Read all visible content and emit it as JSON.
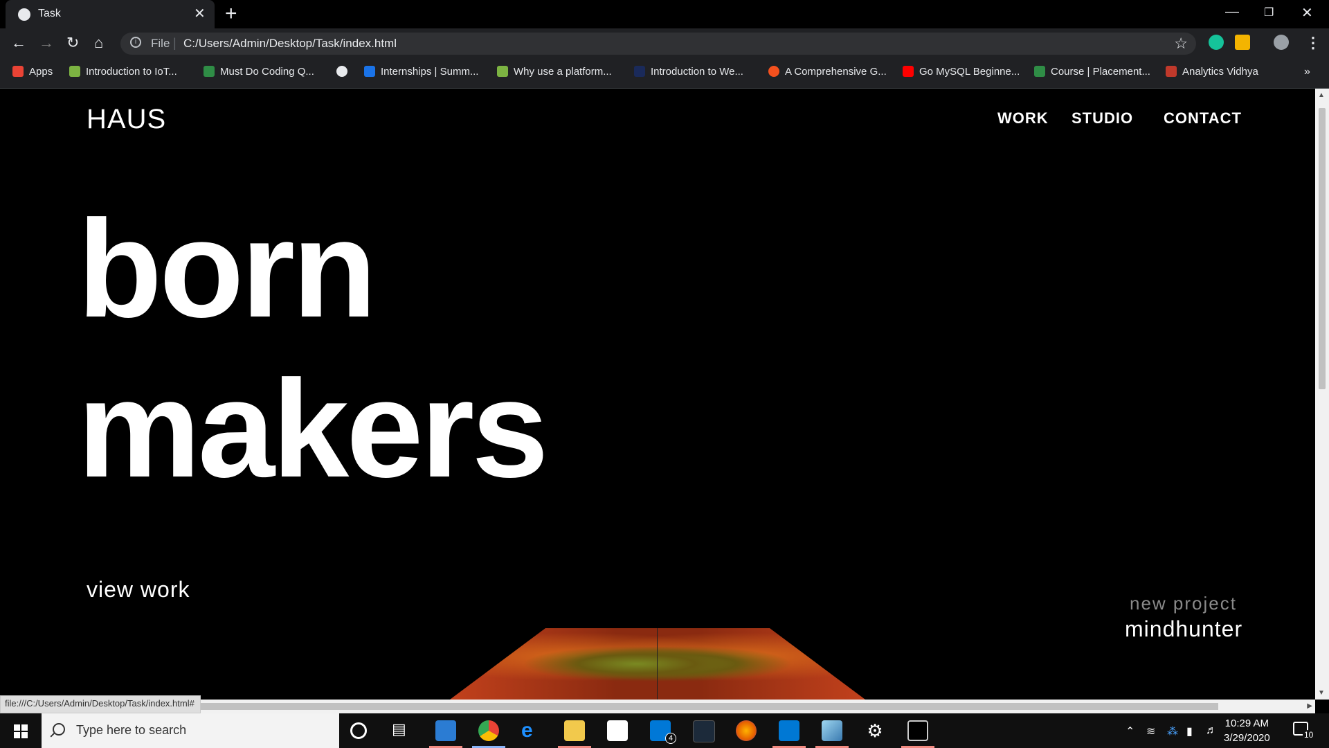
{
  "browser": {
    "tab_title": "Task",
    "tab_close": "✕",
    "new_tab": "+",
    "omnibox_scheme": "File",
    "omnibox_url": "C:/Users/Admin/Desktop/Task/index.html",
    "status_url": "file:///C:/Users/Admin/Desktop/Task/index.html#",
    "bookmarks": [
      {
        "label": "Apps",
        "color": "#ea4335"
      },
      {
        "label": "Introduction to IoT...",
        "color": "#7cb342"
      },
      {
        "label": "Must Do Coding Q...",
        "color": "#2f8d46"
      },
      {
        "label": "",
        "color": "#e8eaed"
      },
      {
        "label": "Internships | Summ...",
        "color": "#1a73e8"
      },
      {
        "label": "Why use a platform...",
        "color": "#7cb342"
      },
      {
        "label": "Introduction to We...",
        "color": "#1a2a5a"
      },
      {
        "label": "A Comprehensive G...",
        "color": "#f4511e"
      },
      {
        "label": "Go MySQL Beginne...",
        "color": "#ff0000"
      },
      {
        "label": "Course | Placement...",
        "color": "#2f8d46"
      },
      {
        "label": "Analytics Vidhya",
        "color": "#c0392b"
      }
    ],
    "bookmarks_overflow": "»"
  },
  "site": {
    "logo": "HAUS",
    "nav": [
      "WORK",
      "STUDIO",
      "CONTACT"
    ],
    "hero_line1": "born",
    "hero_line2": "makers",
    "view_work": "view work",
    "new_project_label": "new project",
    "new_project_title": "mindhunter"
  },
  "taskbar": {
    "search_placeholder": "Type here to search",
    "time": "10:29 AM",
    "date": "3/29/2020",
    "notification_count": "10",
    "mail_badge": "4"
  }
}
